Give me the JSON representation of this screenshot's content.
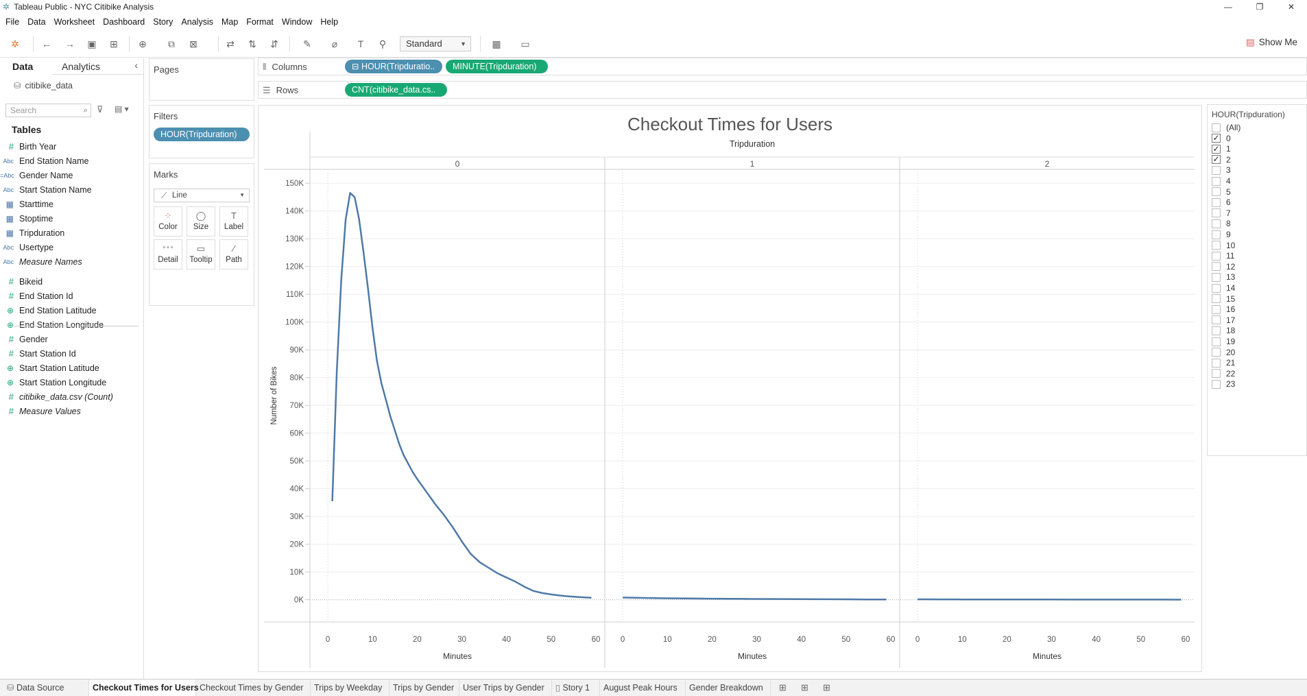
{
  "window": {
    "title": "Tableau Public - NYC Citibike Analysis",
    "controls": [
      "—",
      "❐",
      "✕"
    ]
  },
  "menu": [
    "File",
    "Data",
    "Worksheet",
    "Dashboard",
    "Story",
    "Analysis",
    "Map",
    "Format",
    "Window",
    "Help"
  ],
  "toolbar": {
    "fit_select": "Standard",
    "show_me": "Show Me"
  },
  "data_pane": {
    "tab_data": "Data",
    "tab_analytics": "Analytics",
    "datasource": "citibike_data",
    "search_placeholder": "Search",
    "tables_header": "Tables",
    "fields": [
      {
        "type": "num",
        "icon": "#",
        "label": "Birth Year"
      },
      {
        "type": "abc",
        "icon": "Abc",
        "label": "End Station Name"
      },
      {
        "type": "abc",
        "icon": "=Abc",
        "label": "Gender Name"
      },
      {
        "type": "abc",
        "icon": "Abc",
        "label": "Start Station Name"
      },
      {
        "type": "cal",
        "icon": "▦",
        "label": "Starttime"
      },
      {
        "type": "cal",
        "icon": "▦",
        "label": "Stoptime"
      },
      {
        "type": "cal",
        "icon": "▦",
        "label": "Tripduration"
      },
      {
        "type": "abc",
        "icon": "Abc",
        "label": "Usertype"
      },
      {
        "type": "abc",
        "icon": "Abc",
        "label": "Measure Names",
        "italic": true
      }
    ],
    "measures": [
      {
        "type": "num",
        "icon": "#",
        "label": "Bikeid"
      },
      {
        "type": "num",
        "icon": "#",
        "label": "End Station Id"
      },
      {
        "type": "geo",
        "icon": "⊕",
        "label": "End Station Latitude"
      },
      {
        "type": "geo",
        "icon": "⊕",
        "label": "End Station Longitude"
      },
      {
        "type": "num",
        "icon": "#",
        "label": "Gender"
      },
      {
        "type": "num",
        "icon": "#",
        "label": "Start Station Id"
      },
      {
        "type": "geo",
        "icon": "⊕",
        "label": "Start Station Latitude"
      },
      {
        "type": "geo",
        "icon": "⊕",
        "label": "Start Station Longitude"
      },
      {
        "type": "num",
        "icon": "#",
        "label": "citibike_data.csv (Count)",
        "italic": true
      },
      {
        "type": "num",
        "icon": "#",
        "label": "Measure Values",
        "italic": true
      }
    ]
  },
  "cards": {
    "pages": "Pages",
    "filters": "Filters",
    "filter_pill": "HOUR(Tripduration)",
    "marks": "Marks",
    "marks_type": "Line",
    "mark_buttons": [
      {
        "icon": "⁘",
        "label": "Color"
      },
      {
        "icon": "◯",
        "label": "Size"
      },
      {
        "icon": "T",
        "label": "Label"
      },
      {
        "icon": "∘∘∘",
        "label": "Detail"
      },
      {
        "icon": "▭",
        "label": "Tooltip"
      },
      {
        "icon": "⁄",
        "label": "Path"
      }
    ]
  },
  "shelves": {
    "columns_label": "Columns",
    "columns_pills": [
      "⊟ HOUR(Tripduratio..",
      "MINUTE(Tripduration)"
    ],
    "rows_label": "Rows",
    "rows_pills": [
      "CNT(citibike_data.cs.."
    ]
  },
  "chart_data": {
    "type": "line",
    "title": "Checkout Times for Users",
    "column_header": "Tripduration",
    "panels": [
      "0",
      "1",
      "2"
    ],
    "xlabel": "Minutes",
    "ylabel": "Number of Bikes",
    "xlim": [
      -4,
      62
    ],
    "ylim": [
      -8000,
      155000
    ],
    "x_ticks": [
      0,
      10,
      20,
      30,
      40,
      50,
      60
    ],
    "y_ticks": [
      0,
      10000,
      20000,
      30000,
      40000,
      50000,
      60000,
      70000,
      80000,
      90000,
      100000,
      110000,
      120000,
      130000,
      140000,
      150000
    ],
    "y_tick_labels": [
      "0K",
      "10K",
      "20K",
      "30K",
      "40K",
      "50K",
      "60K",
      "70K",
      "80K",
      "90K",
      "100K",
      "110K",
      "120K",
      "130K",
      "140K",
      "150K"
    ],
    "grid": true,
    "line_color": "#4e79a7",
    "series": [
      {
        "panel": 0,
        "x": [
          1,
          2,
          3,
          4,
          5,
          6,
          7,
          8,
          9,
          10,
          11,
          12,
          13,
          14,
          15,
          16,
          17,
          18,
          19,
          20,
          22,
          24,
          26,
          28,
          30,
          32,
          34,
          36,
          38,
          40,
          42,
          44,
          46,
          48,
          50,
          52,
          54,
          56,
          58,
          59
        ],
        "y": [
          35500,
          82000,
          115000,
          137000,
          146500,
          145000,
          137000,
          125000,
          112000,
          98000,
          86000,
          78000,
          72000,
          66000,
          61000,
          56000,
          52000,
          49000,
          46000,
          43500,
          39000,
          34500,
          30500,
          26000,
          21000,
          16500,
          13500,
          11500,
          9500,
          8000,
          6500,
          4700,
          3200,
          2400,
          1900,
          1500,
          1200,
          1000,
          800,
          700
        ]
      },
      {
        "panel": 1,
        "x": [
          0,
          5,
          10,
          15,
          20,
          25,
          30,
          35,
          40,
          45,
          50,
          55,
          59
        ],
        "y": [
          800,
          650,
          520,
          440,
          380,
          330,
          280,
          240,
          200,
          170,
          140,
          110,
          100
        ]
      },
      {
        "panel": 2,
        "x": [
          0,
          5,
          10,
          15,
          20,
          25,
          30,
          35,
          40,
          45,
          50,
          55,
          59
        ],
        "y": [
          150,
          130,
          110,
          100,
          90,
          80,
          70,
          60,
          55,
          50,
          45,
          40,
          35
        ]
      }
    ]
  },
  "legend": {
    "title": "HOUR(Tripduration)",
    "items": [
      {
        "label": "(All)",
        "checked": false
      },
      {
        "label": "0",
        "checked": true
      },
      {
        "label": "1",
        "checked": true
      },
      {
        "label": "2",
        "checked": true
      },
      {
        "label": "3",
        "checked": false
      },
      {
        "label": "4",
        "checked": false
      },
      {
        "label": "5",
        "checked": false
      },
      {
        "label": "6",
        "checked": false
      },
      {
        "label": "7",
        "checked": false
      },
      {
        "label": "8",
        "checked": false
      },
      {
        "label": "9",
        "checked": false
      },
      {
        "label": "10",
        "checked": false
      },
      {
        "label": "11",
        "checked": false
      },
      {
        "label": "12",
        "checked": false
      },
      {
        "label": "13",
        "checked": false
      },
      {
        "label": "14",
        "checked": false
      },
      {
        "label": "15",
        "checked": false
      },
      {
        "label": "16",
        "checked": false
      },
      {
        "label": "17",
        "checked": false
      },
      {
        "label": "18",
        "checked": false
      },
      {
        "label": "19",
        "checked": false
      },
      {
        "label": "20",
        "checked": false
      },
      {
        "label": "21",
        "checked": false
      },
      {
        "label": "22",
        "checked": false
      },
      {
        "label": "23",
        "checked": false
      }
    ]
  },
  "bottom_tabs": [
    {
      "label": "Data Source",
      "active": false
    },
    {
      "label": "Checkout Times for Users",
      "active": true
    },
    {
      "label": "Checkout Times by Gender",
      "active": false
    },
    {
      "label": "Trips by Weekday",
      "active": false
    },
    {
      "label": "Trips by Gender",
      "active": false
    },
    {
      "label": "User Trips by Gender",
      "active": false
    },
    {
      "label": "Story 1",
      "active": false
    },
    {
      "label": "August Peak Hours",
      "active": false
    },
    {
      "label": "Gender Breakdown",
      "active": false
    }
  ]
}
